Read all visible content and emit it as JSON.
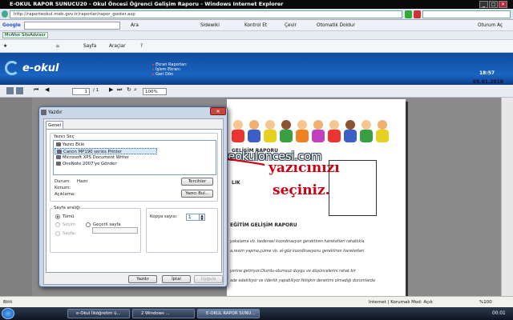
{
  "window": {
    "title": "E-OKUL RAPOR SUNUCU20 - Okul Öncesi Öğrenci Gelişim Raporu - Windows Internet Explorer"
  },
  "address": {
    "url": "http://raporteokul.meb.gov.tr/raporlar/rapor_goster.asp"
  },
  "google_bar": {
    "brand": "Google",
    "search_label": "Ara",
    "items": [
      "Sidewiki",
      "Kontrol Et",
      "Çevir",
      "Otomatik Doldur"
    ],
    "signin": "Oturum Aç"
  },
  "fav_bar": {
    "item": "McAfee SiteAdvisor"
  },
  "cmd_bar": {
    "page": "Sayfa",
    "tools": "Araçlar"
  },
  "banner": {
    "logo": "e-okul",
    "menu": [
      "Ekran Raporları",
      "İşlem Ekranı",
      "Geri Dön"
    ],
    "time": "18:57",
    "date": "05.01.2010"
  },
  "report_toolbar": {
    "page": "1",
    "of": "/ 1",
    "zoom": "100%"
  },
  "report": {
    "title1": "GELİŞİM RAPORU",
    "frag": "LIK",
    "title2": "EĞİTİM GELİŞİM RAPORU",
    "lines": [
      "yakalama vb. bedensel koordinasyon gerektiren hareketleri rahatlıkla",
      "a,resim yapma,çizme vb. el-göz koordinasyonu gerektiren hareketleri",
      "yerine getiriyor.Olumlu-olumsuz duygu ve düşüncelerini rahat bir",
      "ade edebiliyor ve liderlik yapabiliyor.Yetişkin denetimi olmadığı durumlarda"
    ]
  },
  "annotation": {
    "watermark": "www.onceokulonc​esi.com",
    "line1": "yazıcınızı",
    "line2": "seçiniz."
  },
  "dialog": {
    "title": "Yazdır",
    "tab": "Genel",
    "select_label": "Yazıcı Seç",
    "printers": [
      "Yazıcı Ekle",
      "Canon MP190 series Printer",
      "Microsoft XPS Document Writer",
      "OneNote 2007'ye Gönder"
    ],
    "status_label": "Durum:",
    "status_value": "Hazır",
    "location_label": "Konum:",
    "comment_label": "Açıklama:",
    "prefs_btn": "Tercihler",
    "find_btn": "Yazıcı Bul...",
    "range_label": "Sayfa aralığı",
    "range_all": "Tümü",
    "range_sel": "Seçim",
    "range_cur": "Geçerli sayfa",
    "range_pages": "Sayfa:",
    "copies_label": "Kopya sayısı:",
    "copies_value": "1",
    "print_btn": "Yazdır",
    "cancel_btn": "İptal",
    "apply_btn": "Uygula"
  },
  "status": {
    "left": "Bitti",
    "zone": "Internet | Korumalı Mod: Açık",
    "zoom": "%100"
  },
  "taskbar": {
    "tasks": [
      "e-Okul İlköğretim ü...",
      "2 Windows ...",
      "E-OKUL RAPOR SUNU..."
    ],
    "clock": "00:01"
  },
  "colors": {
    "accent": "#1a64c2",
    "annotation": "#cc0010"
  }
}
